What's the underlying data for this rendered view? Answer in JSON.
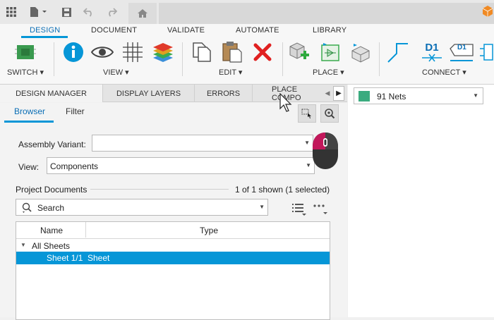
{
  "ribbon": {
    "tabs": [
      "DESIGN",
      "DOCUMENT",
      "VALIDATE",
      "AUTOMATE",
      "LIBRARY"
    ],
    "groups": {
      "switch": "SWITCH",
      "view": "VIEW",
      "edit": "EDIT",
      "place": "PLACE",
      "connect": "CONNECT"
    },
    "connect_label": "D1",
    "connect_label_2": "D1"
  },
  "panel_tabs": [
    "DESIGN MANAGER",
    "DISPLAY LAYERS",
    "ERRORS",
    "PLACE COMPO"
  ],
  "right_panel": {
    "nets_value": "91 Nets",
    "nets_color": "#3aab7f"
  },
  "design_manager": {
    "subtabs": [
      "Browser",
      "Filter"
    ],
    "assembly_variant_label": "Assembly Variant:",
    "assembly_variant_value": "",
    "view_label": "View:",
    "view_value": "Components",
    "project_documents_label": "Project Documents",
    "project_documents_count": "1 of 1 shown (1 selected)",
    "search_placeholder": "Search",
    "table": {
      "columns": [
        "Name",
        "Type"
      ],
      "group_label": "All Sheets",
      "rows": [
        {
          "name": "Sheet 1/1",
          "type": "Sheet",
          "selected": true
        }
      ]
    }
  },
  "colors": {
    "accent": "#0696d7",
    "accent_text": "#0b6eb5",
    "close_red": "#e02020"
  }
}
